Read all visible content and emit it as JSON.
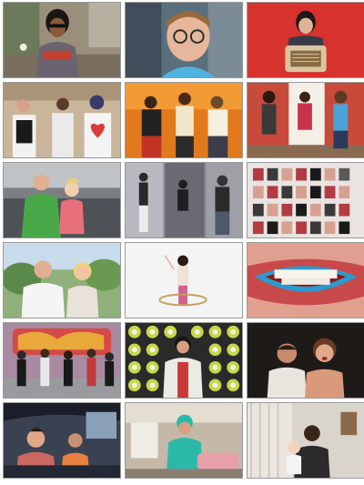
{
  "grid": {
    "columns": 3,
    "rows": 6,
    "thumbnails": [
      {
        "subject": "man-sunglasses-street-tshirt",
        "bg": "#9a8f7a",
        "accent": "#6b5a3c"
      },
      {
        "subject": "young-man-glasses-closeup",
        "bg": "#5a6f7d",
        "accent": "#4fb3e0"
      },
      {
        "subject": "person-red-wall-radio",
        "bg": "#d8322e",
        "accent": "#d9c6a0"
      },
      {
        "subject": "three-dancers-card-costumes",
        "bg": "#c9b59a",
        "accent": "#d93c3c"
      },
      {
        "subject": "three-dancers-orange-stage",
        "bg": "#e07a1c",
        "accent": "#f3e6c8"
      },
      {
        "subject": "three-dancers-living-room",
        "bg": "#c84a3b",
        "accent": "#4aa3d8"
      },
      {
        "subject": "man-child-sofa",
        "bg": "#7c7f82",
        "accent": "#48a848"
      },
      {
        "subject": "dancers-split-collage",
        "bg": "#8d8d95",
        "accent": "#2a2a2a"
      },
      {
        "subject": "photo-collage-wall",
        "bg": "#e9e4e1",
        "accent": "#b23c42"
      },
      {
        "subject": "man-woman-outdoor-dubai",
        "bg": "#8fb07a",
        "accent": "#f5f5f5"
      },
      {
        "subject": "dancer-hula-hoop-white",
        "bg": "#f4f4f4",
        "accent": "#d06090"
      },
      {
        "subject": "smiling-mouth-closeup",
        "bg": "#c84a4a",
        "accent": "#2a9bd0"
      },
      {
        "subject": "dancers-graffiti-wall",
        "bg": "#a88aa2",
        "accent": "#d44a48"
      },
      {
        "subject": "man-polka-dot-wall",
        "bg": "#2a2a2a",
        "accent": "#c5d84a"
      },
      {
        "subject": "two-people-dark-stage",
        "bg": "#1e1a18",
        "accent": "#d89a7a"
      },
      {
        "subject": "people-in-car",
        "bg": "#3a4150",
        "accent": "#c86860"
      },
      {
        "subject": "dentist-office-scene",
        "bg": "#c4b8a8",
        "accent": "#2cb8a8"
      },
      {
        "subject": "man-baby-office",
        "bg": "#d9d4cc",
        "accent": "#2d2a2e"
      }
    ]
  }
}
